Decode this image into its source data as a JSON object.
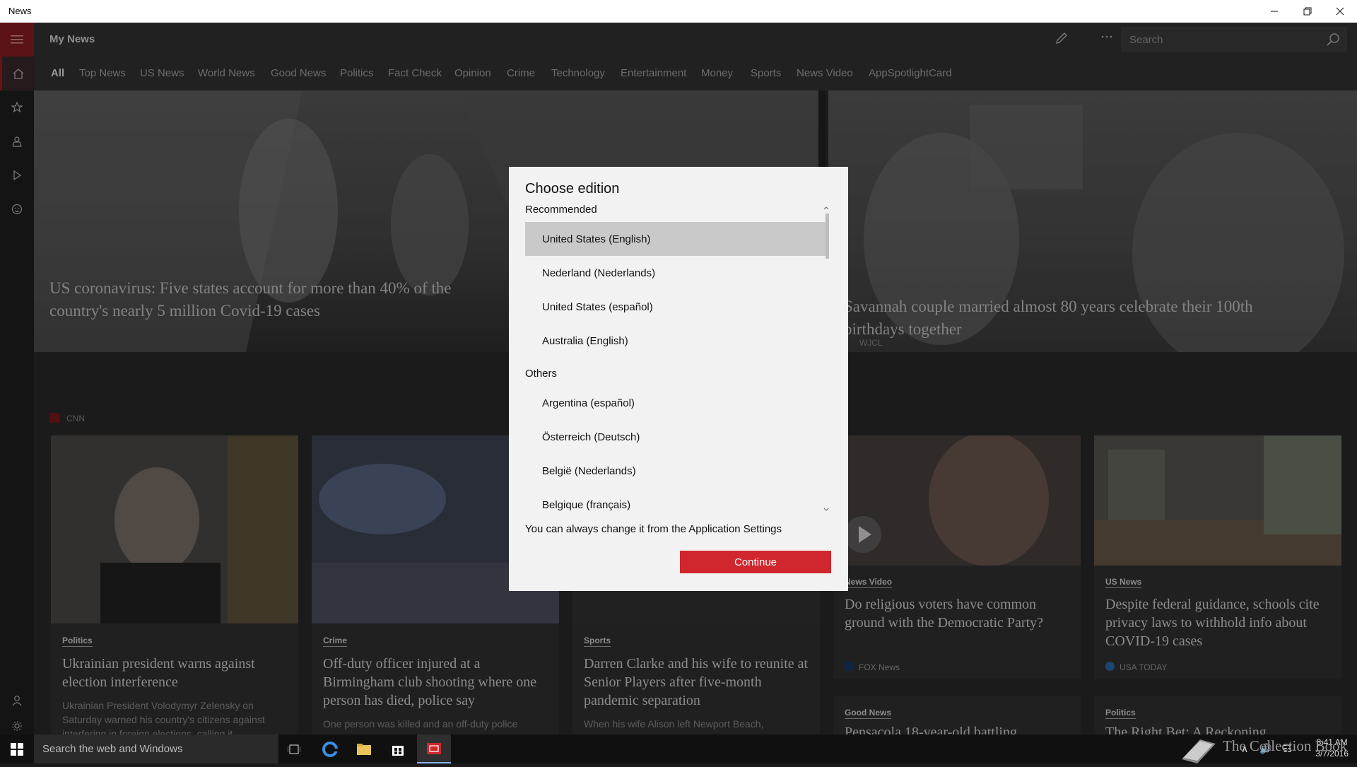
{
  "window": {
    "title": "News"
  },
  "header": {
    "title": "My News",
    "search_placeholder": "Search"
  },
  "tabs": [
    {
      "label": "All"
    },
    {
      "label": "Top News"
    },
    {
      "label": "US News"
    },
    {
      "label": "World News"
    },
    {
      "label": "Good News"
    },
    {
      "label": "Politics"
    },
    {
      "label": "Fact Check"
    },
    {
      "label": "Opinion"
    },
    {
      "label": "Crime"
    },
    {
      "label": "Technology"
    },
    {
      "label": "Entertainment"
    },
    {
      "label": "Money"
    },
    {
      "label": "Sports"
    },
    {
      "label": "News Video"
    },
    {
      "label": "AppSpotlightCard"
    }
  ],
  "hero": {
    "left": {
      "headline": "US coronavirus: Five states account for more than 40% of the country's nearly 5 million Covid-19 cases",
      "source": "CNN"
    },
    "right": {
      "headline": "Savannah couple married almost 80 years celebrate their 100th birthdays together",
      "source": "WJCL"
    }
  },
  "cards": [
    {
      "category": "Politics",
      "headline": "Ukrainian president warns against election interference",
      "snippet": "Ukrainian President Volodymyr Zelensky on Saturday warned his country's citizens against interfering in foreign elections, calling it"
    },
    {
      "category": "Crime",
      "headline": "Off-duty officer injured at a Birmingham club shooting where one person has died, police say",
      "snippet": "One person was killed and an off-duty police"
    },
    {
      "category": "Sports",
      "headline": "Darren Clarke and his wife to reunite at Senior Players after five-month pandemic separation",
      "snippet": "When his wife Alison left Newport Beach, California..."
    },
    {
      "category": "News Video",
      "headline": "Do religious voters have common ground with the Democratic Party?",
      "source": "FOX News"
    },
    {
      "category": "US News",
      "headline": "Despite federal guidance, schools cite privacy laws to withhold info about COVID-19 cases",
      "source": "USA TODAY"
    },
    {
      "category": "Good News",
      "headline": "Pensacola 18-year-old battling"
    },
    {
      "category": "Politics",
      "headline": "The Right Bet: A Reckoning"
    }
  ],
  "dialog": {
    "title": "Choose edition",
    "recommended_label": "Recommended",
    "recommended": [
      "United States (English)",
      "Nederland (Nederlands)",
      "United States (español)",
      "Australia (English)"
    ],
    "others_label": "Others",
    "others": [
      "Argentina (español)",
      "Österreich (Deutsch)",
      "België (Nederlands)",
      "Belgique (français)"
    ],
    "note": "You can always change it from the Application Settings",
    "continue_label": "Continue"
  },
  "taskbar": {
    "search_text": "Search the web and Windows",
    "time": "8:41 AM",
    "date": "3/7/2016"
  },
  "watermark": "The Collection Book",
  "colors": {
    "accent": "#d0262e",
    "rail_accent": "#8c1c22"
  }
}
